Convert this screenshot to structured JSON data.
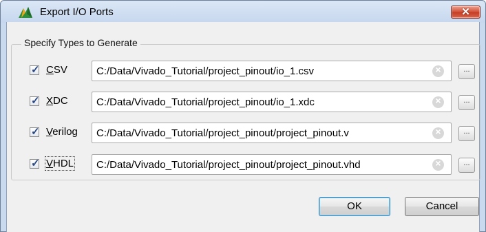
{
  "window": {
    "title": "Export I/O Ports",
    "close_label": "✕"
  },
  "group": {
    "legend": "Specify Types to Generate"
  },
  "rows": [
    {
      "prefix": "",
      "mnemonic": "C",
      "rest": "SV",
      "checked": true,
      "path": "C:/Data/Vivado_Tutorial/project_pinout/io_1.csv"
    },
    {
      "prefix": "",
      "mnemonic": "X",
      "rest": "DC",
      "checked": true,
      "path": "C:/Data/Vivado_Tutorial/project_pinout/io_1.xdc"
    },
    {
      "prefix": "",
      "mnemonic": "V",
      "rest": "erilog",
      "checked": true,
      "path": "C:/Data/Vivado_Tutorial/project_pinout/project_pinout.v"
    },
    {
      "prefix": "",
      "mnemonic": "V",
      "rest": "HDL",
      "checked": true,
      "path": "C:/Data/Vivado_Tutorial/project_pinout/project_pinout.vhd"
    }
  ],
  "common": {
    "check_mark": "✓",
    "clear_glyph": "×",
    "browse_label": "..."
  },
  "buttons": {
    "ok": "OK",
    "cancel": "Cancel"
  },
  "colors": {
    "titlebar": "#c9d9ee",
    "close_button": "#d3533b",
    "dialog_bg": "#f0f0f0"
  }
}
